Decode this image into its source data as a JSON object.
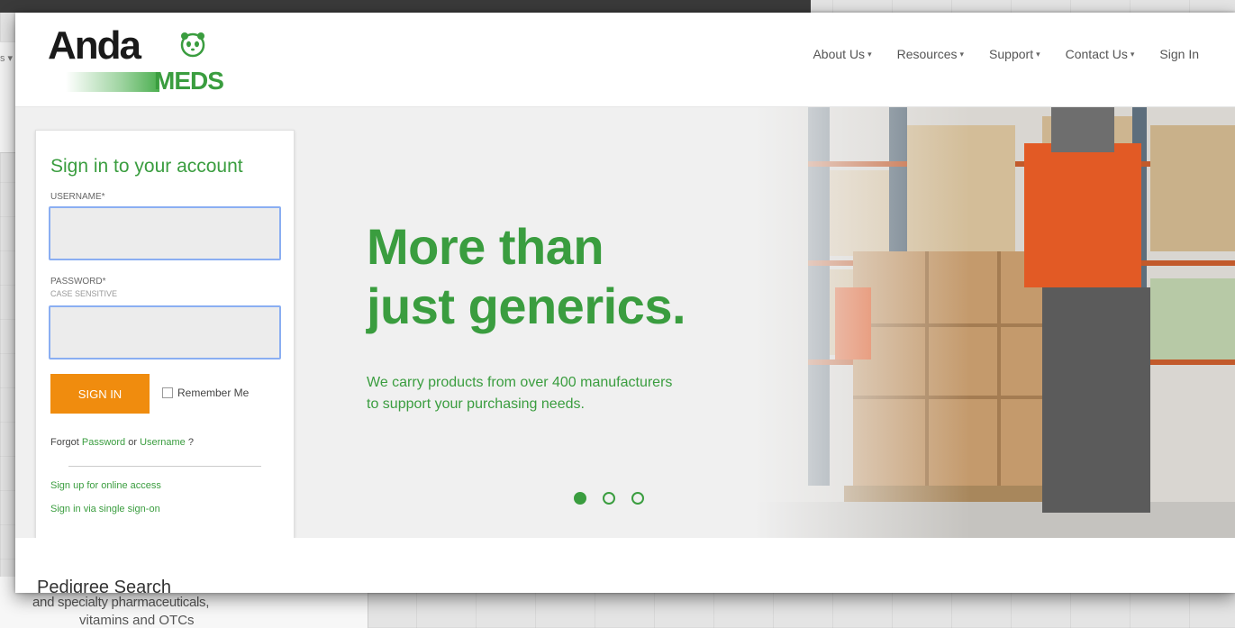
{
  "background": {
    "side_text": "s ▾",
    "bottom_heading": "and specialty pharmaceuticals,",
    "bottom_line2": "vitamins and OTCs"
  },
  "logo": {
    "anda": "Anda",
    "meds": "MEDS"
  },
  "nav": [
    {
      "label": "About Us",
      "caret": "▾"
    },
    {
      "label": "Resources",
      "caret": "▾"
    },
    {
      "label": "Support",
      "caret": "▾"
    },
    {
      "label": "Contact Us",
      "caret": "▾"
    },
    {
      "label": "Sign In",
      "caret": ""
    }
  ],
  "hero": {
    "title_line1": "More than",
    "title_line2": "just generics.",
    "subtitle_line1": "We carry products from over 400 manufacturers",
    "subtitle_line2": "to support your purchasing needs.",
    "active_slide": 1,
    "slide_count": 3
  },
  "login": {
    "title": "Sign in to your account",
    "username_label": "USERNAME*",
    "username_value": "",
    "password_label": "PASSWORD*",
    "password_hint": "CASE SENSITIVE",
    "password_value": "",
    "signin_button": "SIGN IN",
    "remember_me": "Remember Me",
    "forgot_prefix": "Forgot ",
    "forgot_password": "Password",
    "forgot_or": " or ",
    "forgot_username": "Username",
    "forgot_suffix": " ?",
    "signup_link": "Sign up for online access",
    "sso_link": "Sign in via single sign-on"
  },
  "below_hero": {
    "heading": "Pedigree Search"
  },
  "colors": {
    "brand_green": "#3a9d3f",
    "signin_orange": "#f08c0e",
    "field_border": "#8aaef2"
  }
}
